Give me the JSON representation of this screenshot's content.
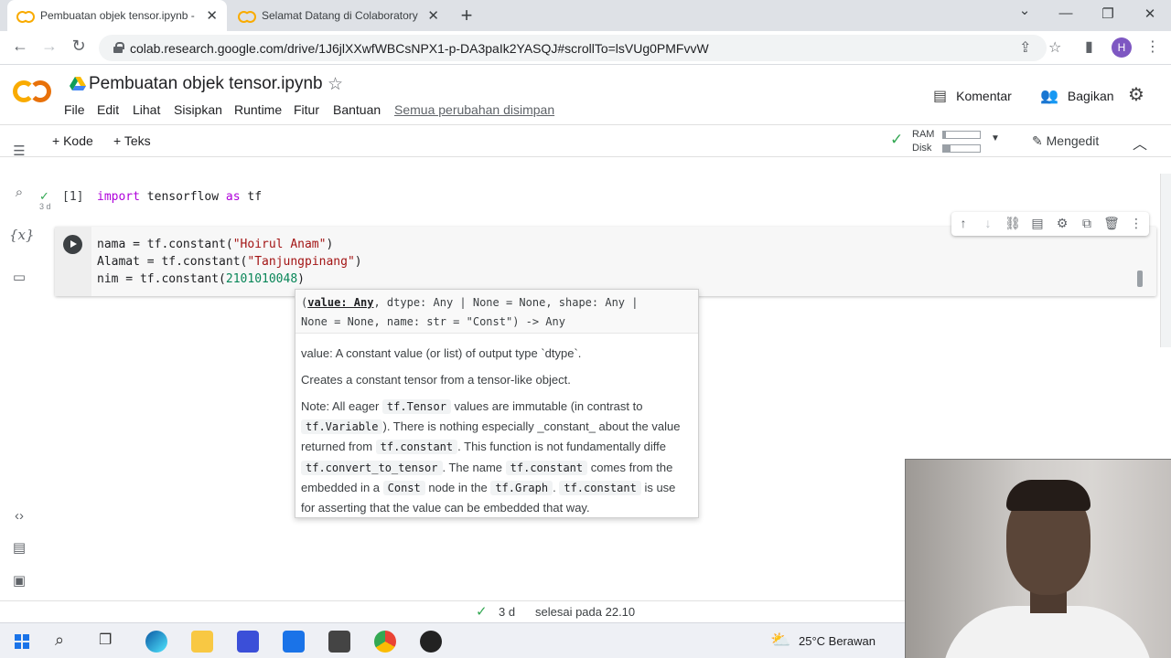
{
  "browser": {
    "tabs": [
      {
        "title": "Pembuatan objek tensor.ipynb - ",
        "close": "✕",
        "active": true
      },
      {
        "title": "Selamat Datang di Colaboratory",
        "close": "✕",
        "active": false
      }
    ],
    "new_tab": "+",
    "window_controls": {
      "minimize": "⌄",
      "min2": "—",
      "restore": "❐",
      "close": "✕"
    },
    "url": "colab.research.google.com/drive/1J6jlXXwfWBCsNPX1-p-DA3paIk2YASQJ#scrollTo=lsVUg0PMFvvW",
    "profile_initial": "H"
  },
  "colab": {
    "notebook_title": "Pembuatan objek tensor.ipynb",
    "menu": [
      "File",
      "Edit",
      "Lihat",
      "Sisipkan",
      "Runtime",
      "Fitur",
      "Bantuan"
    ],
    "saved_status": "Semua perubahan disimpan",
    "comment_label": "Komentar",
    "share_label": "Bagikan",
    "add_code": "+ Kode",
    "add_text": "+ Teks",
    "ram_label": "RAM",
    "disk_label": "Disk",
    "ram_fraction": 0.08,
    "disk_fraction": 0.2,
    "mode_label": "Mengedit"
  },
  "cells": {
    "cell1": {
      "exec_count": "[1]",
      "status_time": "3 d",
      "line": {
        "kw1": "import",
        "mid": " tensorflow ",
        "kw2": "as",
        "end": " tf"
      }
    },
    "cell2": {
      "line1": {
        "a": "nama = tf.constant(",
        "s": "\"Hoirul Anam\"",
        "b": ")"
      },
      "line2": {
        "a": "Alamat = tf.constant(",
        "s": "\"Tanjungpinang\"",
        "b": ")"
      },
      "line3": {
        "a": "nim = tf.constant(",
        "n": "2101010048",
        "b": ")"
      }
    }
  },
  "tooltip": {
    "sig1_open": "(",
    "sig1_bold": "value: Any",
    "sig1_rest": ", dtype: Any | None = None, shape: Any |",
    "sig2": "None = None, name: str = \"Const\") -> Any",
    "p1": "value: A constant value (or list) of output type `dtype`.",
    "p2": "Creates a constant tensor from a tensor-like object.",
    "p3_a": "Note: All eager ",
    "p3_c1": "tf.Tensor",
    "p3_b": " values are immutable (in contrast to",
    "p4_c1": "tf.Variable",
    "p4_b": "). There is nothing especially _constant_ about the value",
    "p5_a": "returned from ",
    "p5_c1": "tf.constant",
    "p5_b": ". This function is not fundamentally diffe",
    "p6_c1": "tf.convert_to_tensor",
    "p6_a": ". The name ",
    "p6_c2": "tf.constant",
    "p6_b": " comes from the",
    "p7_a": "embedded in a ",
    "p7_c1": "Const",
    "p7_b": " node in the ",
    "p7_c2": "tf.Graph",
    "p7_c": ". ",
    "p7_c3": "tf.constant",
    "p7_d": " is use",
    "p8": "for asserting that the value can be embedded that way."
  },
  "statusbar": {
    "time": "3 d",
    "done": "selesai pada 22.10"
  },
  "taskbar": {
    "weather": "25°C  Berawan"
  },
  "colors": {
    "accent_green": "#34a853",
    "colab_orange": "#f9ab00",
    "profile": "#7e57c2"
  }
}
